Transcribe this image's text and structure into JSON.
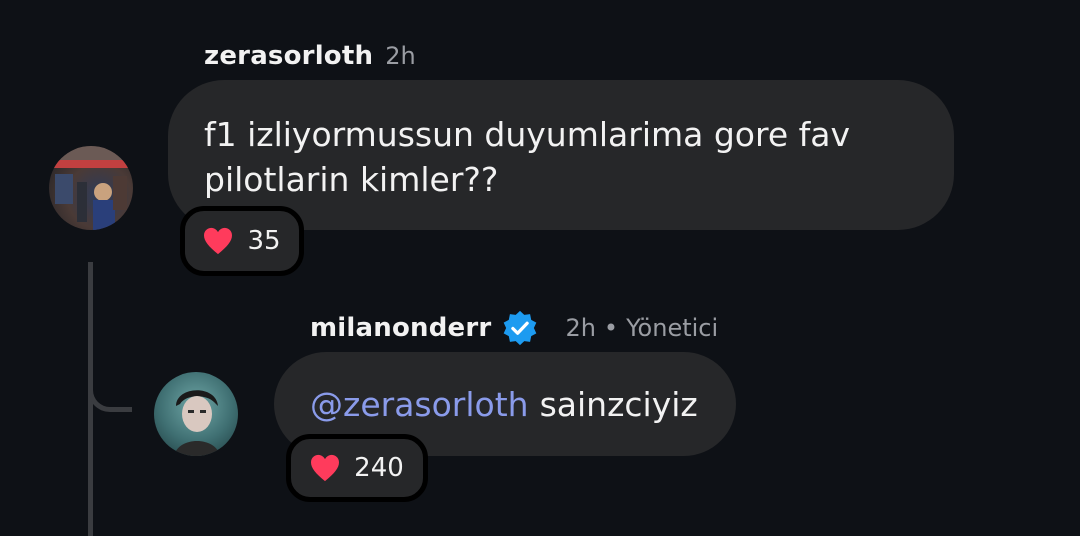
{
  "comments": [
    {
      "username": "zerasorloth",
      "time": "2h",
      "text": "f1 izliyormussun duyumlarima gore fav pilotlarin kimler??",
      "text_line1": "f1 izliyormussun duyumlarima gore fav",
      "text_line2": "pilotlarin kimler??",
      "reaction_count": "35"
    },
    {
      "username": "milanonderr",
      "verified": true,
      "time": "2h",
      "separator": "•",
      "role": "Yönetici",
      "mention": "@zerasorloth",
      "text": "sainzciyiz",
      "reaction_count": "240"
    }
  ],
  "colors": {
    "background": "#0e1116",
    "bubble": "#262729",
    "mention": "#8a9bea",
    "verified": "#1d9bf0",
    "heart": "#ff3b5c"
  },
  "icons": [
    "heart-icon",
    "verified-badge-icon"
  ]
}
